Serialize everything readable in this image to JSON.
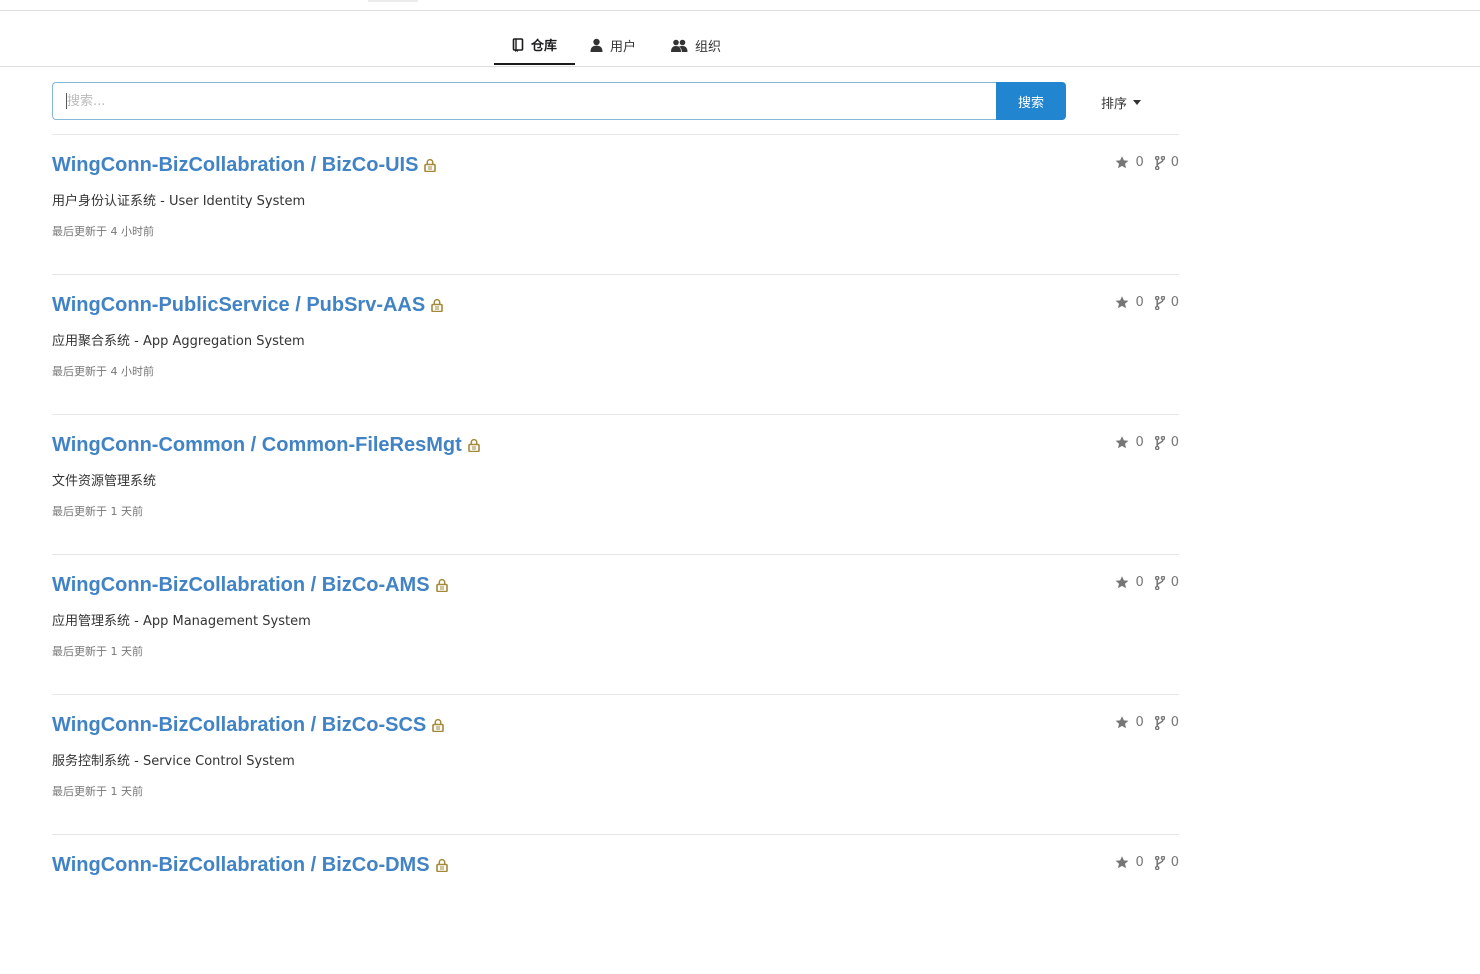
{
  "tabs": [
    {
      "label": "仓库",
      "icon": "repo-book-icon"
    },
    {
      "label": "用户",
      "icon": "user-icon"
    },
    {
      "label": "组织",
      "icon": "users-icon"
    }
  ],
  "search": {
    "placeholder": "搜索...",
    "value": "",
    "button_label": "搜索"
  },
  "sort": {
    "label": "排序",
    "icon": "caret-down-icon"
  },
  "colors": {
    "link": "#4183c4",
    "primary_button": "#2185d0",
    "lock": "#a3893a",
    "meta": "#767676"
  },
  "repos": [
    {
      "owner": "WingConn-BizCollabration",
      "name": "BizCo-UIS",
      "description": "用户身份认证系统 - User Identity System",
      "updated": "最后更新于 4 小时前",
      "stars": "0",
      "forks": "0",
      "private": true
    },
    {
      "owner": "WingConn-PublicService",
      "name": "PubSrv-AAS",
      "description": "应用聚合系统 - App Aggregation System",
      "updated": "最后更新于 4 小时前",
      "stars": "0",
      "forks": "0",
      "private": true
    },
    {
      "owner": "WingConn-Common",
      "name": "Common-FileResMgt",
      "description": "文件资源管理系统",
      "updated": "最后更新于 1 天前",
      "stars": "0",
      "forks": "0",
      "private": true
    },
    {
      "owner": "WingConn-BizCollabration",
      "name": "BizCo-AMS",
      "description": "应用管理系统 - App Management System",
      "updated": "最后更新于 1 天前",
      "stars": "0",
      "forks": "0",
      "private": true
    },
    {
      "owner": "WingConn-BizCollabration",
      "name": "BizCo-SCS",
      "description": "服务控制系统 - Service Control System",
      "updated": "最后更新于 1 天前",
      "stars": "0",
      "forks": "0",
      "private": true
    },
    {
      "owner": "WingConn-BizCollabration",
      "name": "BizCo-DMS",
      "description": "",
      "updated": "",
      "stars": "0",
      "forks": "0",
      "private": true
    }
  ]
}
